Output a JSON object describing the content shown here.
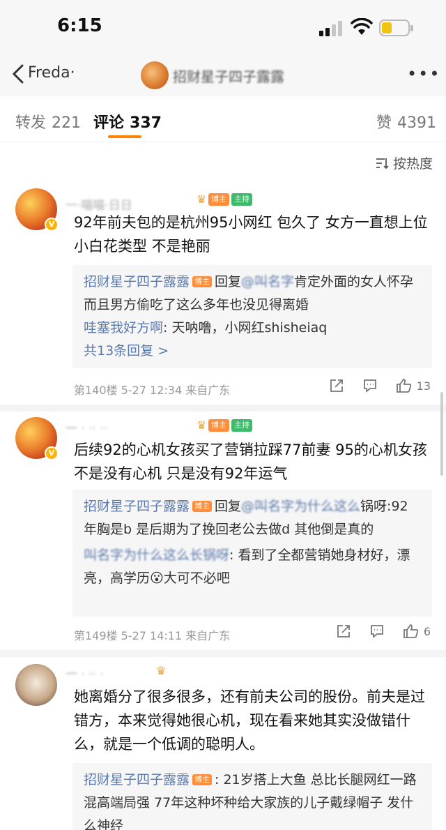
{
  "status": {
    "time": "6:15"
  },
  "nav": {
    "user": "Freda·",
    "title": "招财星子四子露露"
  },
  "tabs": [
    {
      "label": "转发",
      "count": "221"
    },
    {
      "label": "评论",
      "count": "337"
    },
    {
      "label": "赞",
      "count": "4391"
    }
  ],
  "sort_label": "按热度",
  "comments": [
    {
      "badges": [
        "博主",
        "主持"
      ],
      "text": "92年前夫包的是杭州95小网红 包久了 女方一直想上位 小白花类型 不是艳丽",
      "replies": [
        {
          "name": "招财星子四子露露",
          "tag": "博主",
          "prefix": "回复",
          "blurred": "@叫名字",
          "text": "肯定外面的女人怀孕 而且男方偷吃了这么多年也没见得离婚"
        },
        {
          "name": "哇塞我好方啊",
          "text": "天呐噜，小网红shisheiaq"
        }
      ],
      "reply_count": "共13条回复 >",
      "meta": "第140楼 5-27 12:34 来自广东",
      "likes": "13"
    },
    {
      "badges": [
        "博主",
        "主持"
      ],
      "text": "后续92的心机女孩买了营销拉踩77前妻  95的心机女孩不是没有心机 只是没有92年运气",
      "replies": [
        {
          "name": "招财星子四子露露",
          "tag": "博主",
          "prefix": "回复",
          "blurred": "@叫名字为什么这么",
          "text": "锅呀:92年胸是b 是后期为了挽回老公去做d 其他倒是真的"
        },
        {
          "name": "叫名字为什么这么长锅呀",
          "text": "看到了全都营销她身材好，漂亮，高学历😮大可不必吧"
        }
      ],
      "meta": "第149楼 5-27 14:11 来自广东",
      "likes": "6"
    },
    {
      "text": "她离婚分了很多很多，还有前夫公司的股份。前夫是过错方，本来觉得她很心机，现在看来她其实没做错什么，就是一个低调的聪明人。",
      "replies": [
        {
          "name": "招财星子四子露露",
          "tag": "博主",
          "text": "21岁搭上大鱼 总比长腿网红一路混高端局强 77年这种坏种给大家族的儿子戴绿帽子 发什么神经"
        }
      ]
    }
  ]
}
